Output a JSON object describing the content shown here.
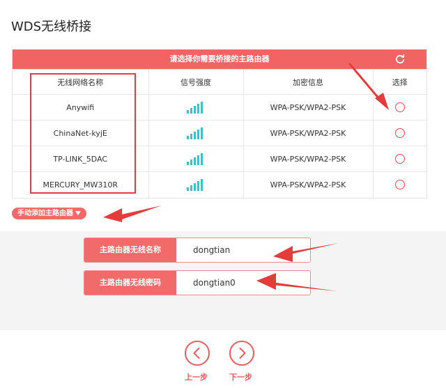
{
  "page": {
    "title": "WDS无线桥接"
  },
  "scan_table": {
    "header_title": "请选择你需要桥接的主路由器",
    "refresh_icon": "refresh-icon",
    "columns": {
      "name": "无线网络名称",
      "signal": "信号强度",
      "encryption": "加密信息",
      "select": "选择"
    },
    "rows": [
      {
        "ssid": "Anywifi",
        "signal_bars": 5,
        "encryption": "WPA-PSK/WPA2-PSK",
        "selected": false
      },
      {
        "ssid": "ChinaNet-kyjE",
        "signal_bars": 5,
        "encryption": "WPA-PSK/WPA2-PSK",
        "selected": false
      },
      {
        "ssid": "TP-LINK_5DAC",
        "signal_bars": 5,
        "encryption": "WPA-PSK/WPA2-PSK",
        "selected": false
      },
      {
        "ssid": "MERCURY_MW310R",
        "signal_bars": 5,
        "encryption": "WPA-PSK/WPA2-PSK",
        "selected": false
      }
    ]
  },
  "manual_add": {
    "label": "手动添加主路由器"
  },
  "form": {
    "ssid_label": "主路由器无线名称",
    "ssid_value": "dongtian",
    "password_label": "主路由器无线密码",
    "password_value": "dongtian0"
  },
  "nav": {
    "prev_label": "上一步",
    "next_label": "下一步"
  },
  "colors": {
    "accent": "#f26363",
    "signal": "#3bbfd1",
    "annotation": "#e53b3b"
  }
}
